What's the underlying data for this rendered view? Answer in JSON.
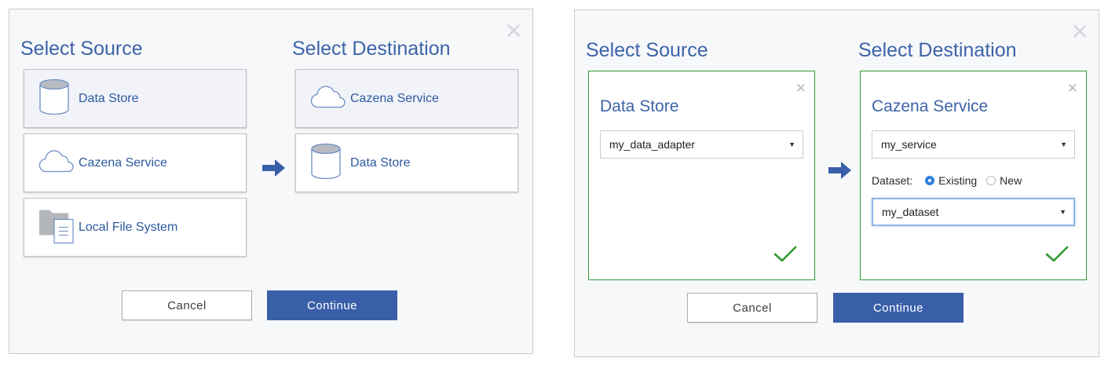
{
  "panel_a": {
    "close_glyph": "✕",
    "source_heading": "Select Source",
    "destination_heading": "Select Destination",
    "source_options": [
      {
        "label": "Data Store",
        "icon": "cylinder-icon",
        "selected": true
      },
      {
        "label": "Cazena Service",
        "icon": "cloud-icon",
        "selected": false
      },
      {
        "label": "Local File System",
        "icon": "folder-file-icon",
        "selected": false
      }
    ],
    "destination_options": [
      {
        "label": "Cazena Service",
        "icon": "cloud-icon",
        "selected": true
      },
      {
        "label": "Data Store",
        "icon": "cylinder-icon",
        "selected": false
      }
    ],
    "cancel_label": "Cancel",
    "continue_label": "Continue"
  },
  "panel_b": {
    "close_glyph": "✕",
    "source_heading": "Select Source",
    "destination_heading": "Select Destination",
    "source_box": {
      "close_glyph": "✕",
      "title": "Data Store",
      "adapter_value": "my_data_adapter"
    },
    "destination_box": {
      "close_glyph": "✕",
      "title": "Cazena Service",
      "service_value": "my_service",
      "dataset_label": "Dataset:",
      "radio_existing": "Existing",
      "radio_new": "New",
      "dataset_value": "my_dataset"
    },
    "cancel_label": "Cancel",
    "continue_label": "Continue"
  },
  "colors": {
    "accent_blue": "#3a5fa9",
    "heading_blue": "#3d63a8",
    "success_green": "#2f9a2f",
    "radio_selected": "#2f7fe0"
  },
  "icons": [
    "close-icon",
    "cylinder-icon",
    "cloud-icon",
    "folder-file-icon",
    "arrow-right-icon",
    "checkmark-icon",
    "caret-down-icon"
  ]
}
